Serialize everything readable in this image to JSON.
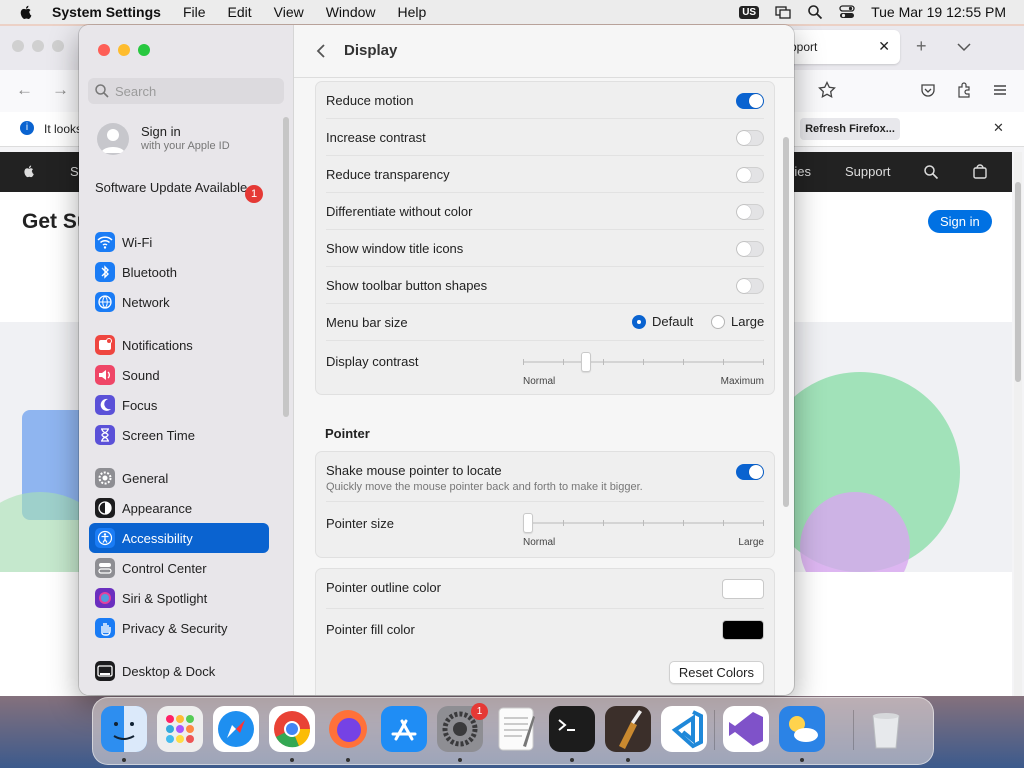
{
  "menubar": {
    "app_name": "System Settings",
    "menus": [
      "File",
      "Edit",
      "View",
      "Window",
      "Help"
    ],
    "input_badge": "US",
    "clock": "Tue Mar 19  12:55 PM"
  },
  "browser": {
    "tab_title": "pport",
    "notice_text": "It looks",
    "notice_button": "Refresh Firefox...",
    "nav_items": {
      "left_fragment": "S",
      "ries": "ries",
      "support": "Support"
    },
    "page_heading": "Get Su",
    "signin_button": "Sign in"
  },
  "window": {
    "title": "Display",
    "search_placeholder": "Search",
    "account": {
      "name": "Sign in",
      "subtitle": "with your Apple ID"
    },
    "software_update": {
      "label": "Software Update Available",
      "count": "1"
    },
    "sidebar_items": [
      {
        "label": "Wi-Fi",
        "icon": "wifi-icon",
        "color": "#1a7cf5"
      },
      {
        "label": "Bluetooth",
        "icon": "bluetooth-icon",
        "color": "#1a7cf5"
      },
      {
        "label": "Network",
        "icon": "globe-icon",
        "color": "#1a7cf5"
      },
      {
        "label": "Notifications",
        "icon": "bell-icon",
        "color": "#ef4640"
      },
      {
        "label": "Sound",
        "icon": "speaker-icon",
        "color": "#ef4667"
      },
      {
        "label": "Focus",
        "icon": "moon-icon",
        "color": "#5b51d8"
      },
      {
        "label": "Screen Time",
        "icon": "hourglass-icon",
        "color": "#5b51d8"
      },
      {
        "label": "General",
        "icon": "gear-icon",
        "color": "#8e8e93"
      },
      {
        "label": "Appearance",
        "icon": "appearance-icon",
        "color": "#1c1c1e"
      },
      {
        "label": "Accessibility",
        "icon": "accessibility-icon",
        "color": "#1a7cf5"
      },
      {
        "label": "Control Center",
        "icon": "control-center-icon",
        "color": "#8e8e93"
      },
      {
        "label": "Siri & Spotlight",
        "icon": "siri-icon",
        "color": "#6b2fbf"
      },
      {
        "label": "Privacy & Security",
        "icon": "hand-icon",
        "color": "#1a7cf5"
      },
      {
        "label": "Desktop & Dock",
        "icon": "dock-icon",
        "color": "#1c1c1e"
      }
    ],
    "selected_item": "Accessibility",
    "display_options": [
      {
        "label": "Reduce motion",
        "on": true
      },
      {
        "label": "Increase contrast",
        "on": false
      },
      {
        "label": "Reduce transparency",
        "on": false
      },
      {
        "label": "Differentiate without color",
        "on": false
      },
      {
        "label": "Show window title icons",
        "on": false
      },
      {
        "label": "Show toolbar button shapes",
        "on": false
      }
    ],
    "menu_bar_size": {
      "label": "Menu bar size",
      "options": [
        "Default",
        "Large"
      ],
      "selected": "Default"
    },
    "display_contrast": {
      "label": "Display contrast",
      "min_label": "Normal",
      "max_label": "Maximum",
      "value": 0.25
    },
    "pointer_section": "Pointer",
    "shake_pointer": {
      "label": "Shake mouse pointer to locate",
      "description": "Quickly move the mouse pointer back and forth to make it bigger.",
      "on": true
    },
    "pointer_size": {
      "label": "Pointer size",
      "min_label": "Normal",
      "max_label": "Large",
      "value": 0.0
    },
    "pointer_outline": {
      "label": "Pointer outline color",
      "color": "#ffffff"
    },
    "pointer_fill": {
      "label": "Pointer fill color",
      "color": "#000000"
    },
    "reset_button": "Reset Colors"
  },
  "dock": {
    "apps": [
      {
        "name": "Finder",
        "icon": "finder-icon",
        "running": true
      },
      {
        "name": "Launchpad",
        "icon": "launchpad-icon",
        "running": false
      },
      {
        "name": "Safari",
        "icon": "safari-icon",
        "running": false
      },
      {
        "name": "Chrome",
        "icon": "chrome-icon",
        "running": true
      },
      {
        "name": "Firefox",
        "icon": "firefox-icon",
        "running": true
      },
      {
        "name": "App Store",
        "icon": "app-store-icon",
        "running": false
      },
      {
        "name": "System Settings",
        "icon": "system-settings-icon",
        "running": true,
        "badge": "1"
      },
      {
        "name": "TextEdit",
        "icon": "textedit-icon",
        "running": false
      },
      {
        "name": "Terminal",
        "icon": "terminal-icon",
        "running": true
      },
      {
        "name": "GarageBand",
        "icon": "garageband-icon",
        "running": true
      },
      {
        "name": "Visual Studio Code",
        "icon": "vscode-icon",
        "running": false
      },
      {
        "name": "Visual Studio",
        "icon": "visual-studio-icon",
        "running": false
      },
      {
        "name": "Weather",
        "icon": "weather-icon",
        "running": true
      },
      {
        "name": "Trash",
        "icon": "trash-icon",
        "running": false
      }
    ]
  }
}
